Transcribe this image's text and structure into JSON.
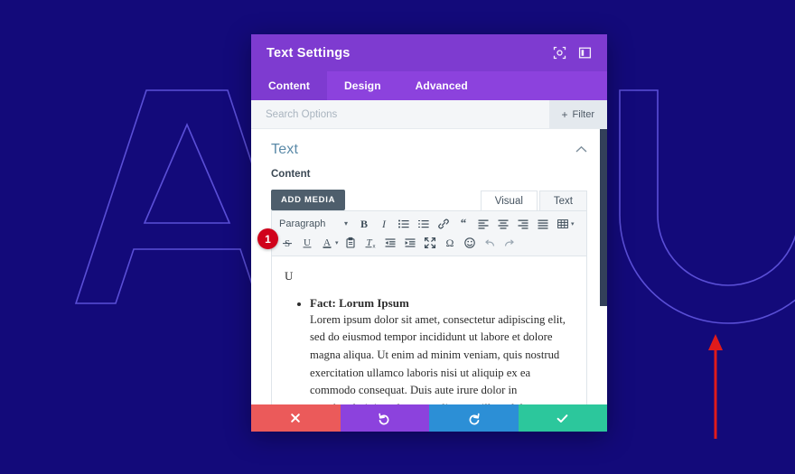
{
  "background": {
    "color": "#130a7a",
    "letters": [
      "A",
      "U"
    ],
    "outline_color": "#5a4fd6"
  },
  "annotation": {
    "arrow_color": "#e01b1b",
    "step_badge": "1",
    "step_badge_color": "#d0021b"
  },
  "panel": {
    "title": "Text Settings",
    "header_color": "#7e3bd0",
    "header_icons": [
      {
        "name": "preview-icon"
      },
      {
        "name": "layout-toggle-icon"
      }
    ],
    "tabs": [
      {
        "label": "Content",
        "active": true
      },
      {
        "label": "Design",
        "active": false
      },
      {
        "label": "Advanced",
        "active": false
      }
    ],
    "search": {
      "placeholder": "Search Options",
      "value": ""
    },
    "filter": {
      "label": "Filter",
      "plus": "+"
    },
    "section": {
      "title": "Text",
      "collapse_icon": "⌃"
    },
    "field": {
      "label": "Content"
    },
    "editor": {
      "add_media_label": "ADD MEDIA",
      "mode_tabs": [
        {
          "label": "Visual",
          "active": true
        },
        {
          "label": "Text",
          "active": false
        }
      ],
      "format_select": {
        "value": "Paragraph",
        "caret": "▾"
      },
      "toolbar_row1": [
        {
          "name": "bold-icon",
          "title": "Bold"
        },
        {
          "name": "italic-icon",
          "title": "Italic"
        },
        {
          "name": "bulleted-list-icon",
          "title": "Bulleted list"
        },
        {
          "name": "numbered-list-icon",
          "title": "Numbered list"
        },
        {
          "name": "link-icon",
          "title": "Insert link"
        },
        {
          "name": "blockquote-icon",
          "title": "Blockquote"
        },
        {
          "name": "align-left-icon",
          "title": "Align left"
        },
        {
          "name": "align-center-icon",
          "title": "Align center"
        },
        {
          "name": "align-right-icon",
          "title": "Align right"
        },
        {
          "name": "align-justify-icon",
          "title": "Justify"
        },
        {
          "name": "table-icon",
          "title": "Table"
        }
      ],
      "toolbar_row2": [
        {
          "name": "strikethrough-icon",
          "title": "Strikethrough"
        },
        {
          "name": "underline-icon",
          "title": "Underline"
        },
        {
          "name": "text-color-icon",
          "title": "Text color"
        },
        {
          "name": "paste-as-text-icon",
          "title": "Paste as text"
        },
        {
          "name": "clear-formatting-icon",
          "title": "Clear formatting"
        },
        {
          "name": "outdent-icon",
          "title": "Decrease indent"
        },
        {
          "name": "indent-icon",
          "title": "Increase indent"
        },
        {
          "name": "fullscreen-icon",
          "title": "Fullscreen"
        },
        {
          "name": "special-character-icon",
          "title": "Special character"
        },
        {
          "name": "emoji-icon",
          "title": "Emoji"
        },
        {
          "name": "undo-icon",
          "title": "Undo"
        },
        {
          "name": "redo-icon",
          "title": "Redo"
        }
      ],
      "content": {
        "stray_char": "U",
        "list_item_title": "Fact: Lorum Ipsum",
        "list_item_body": "Lorem ipsum dolor sit amet, consectetur adipiscing elit, sed do eiusmod tempor incididunt ut labore et dolore magna aliqua. Ut enim ad minim veniam, quis nostrud exercitation ullamco laboris nisi ut aliquip ex ea commodo consequat. Duis aute irure dolor in reprehenderit in voluptate velit esse cillum dolore eu fugiat nulla pariatur."
      }
    },
    "footer_buttons": [
      {
        "name": "discard-button",
        "icon": "close-icon",
        "color": "#eb5a5a"
      },
      {
        "name": "undo-button",
        "icon": "undo-arrow-icon",
        "color": "#8c42dd"
      },
      {
        "name": "redo-button",
        "icon": "redo-arrow-icon",
        "color": "#2c8fd6"
      },
      {
        "name": "save-button",
        "icon": "check-icon",
        "color": "#2cc79c"
      }
    ]
  }
}
